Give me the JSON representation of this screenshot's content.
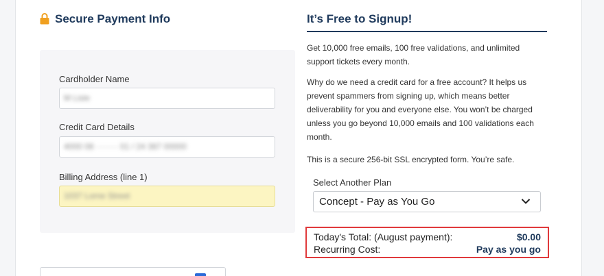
{
  "left": {
    "title": "Secure Payment Info",
    "fields": [
      {
        "label": "Cardholder Name",
        "value": "M Lisle"
      },
      {
        "label": "Credit Card Details",
        "value": "4000  08 ········  01 / 24  387  00000"
      },
      {
        "label": "Billing Address (line 1)",
        "value": "1037 Lorne Street"
      }
    ]
  },
  "right": {
    "title": "It’s Free to Signup!",
    "paragraphs": [
      "Get 10,000 free emails, 100 free validations, and unlimited support tickets every month.",
      "Why do we need a credit card for a free account? It helps us prevent spammers from signing up, which means better deliverability for you and everyone else. You won’t be charged unless you go beyond 10,000 emails and 100 validations each month.",
      "This is a secure 256-bit SSL encrypted form. You’re safe."
    ],
    "plan_label": "Select Another Plan",
    "plan_value": "Concept - Pay as You Go",
    "totals": {
      "today_label": "Today's Total: (August payment):",
      "today_value": "$0.00",
      "recurring_label": "Recurring Cost:",
      "recurring_value": "Pay as you go"
    }
  },
  "colors": {
    "heading": "#1f3a5c",
    "lock": "#f0a020",
    "highlight_field": "#fcf5c2",
    "total_border": "#e0393b"
  },
  "icons": [
    "lock-icon",
    "chevron-down-icon"
  ]
}
